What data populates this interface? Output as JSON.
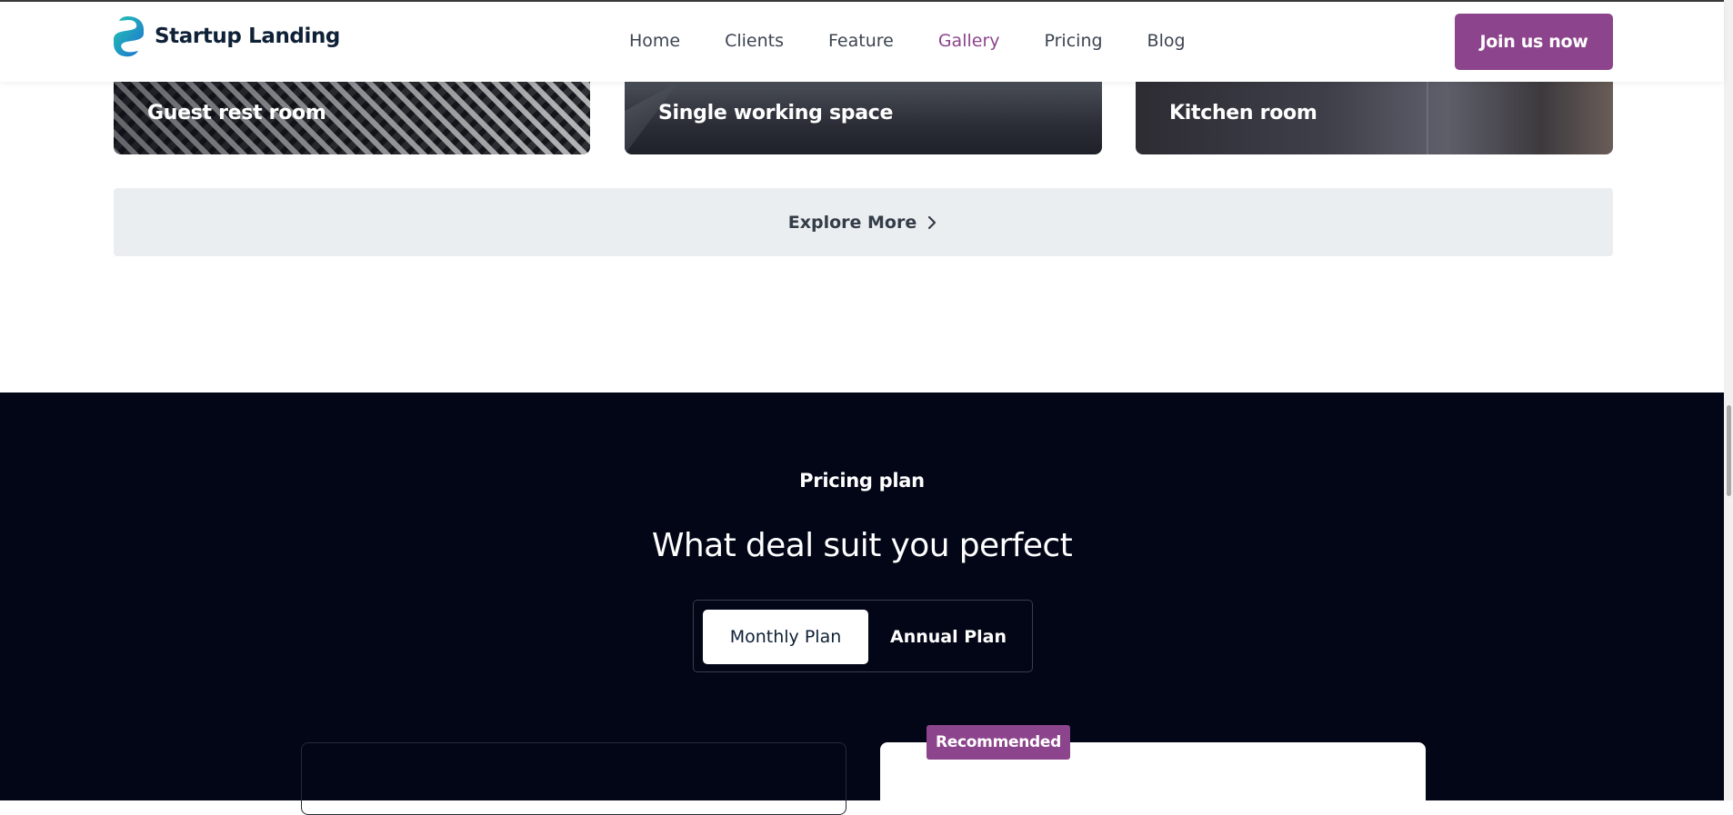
{
  "header": {
    "brand": "Startup Landing",
    "nav": [
      "Home",
      "Clients",
      "Feature",
      "Gallery",
      "Pricing",
      "Blog"
    ],
    "active_nav": "Gallery",
    "cta_label": "Join us now"
  },
  "gallery": {
    "cards": [
      {
        "label": "Guest rest room"
      },
      {
        "label": "Single working space"
      },
      {
        "label": "Kitchen room"
      }
    ],
    "explore_label": "Explore More"
  },
  "pricing": {
    "eyebrow": "Pricing plan",
    "heading": "What deal suit you perfect",
    "toggle": {
      "monthly": "Monthly Plan",
      "annual": "Annual Plan",
      "selected": "Monthly Plan"
    },
    "badge": "Recommended"
  },
  "colors": {
    "accent": "#8c458c",
    "dark_bg": "#020617",
    "explore_bg": "#ebeef1",
    "logo_teal": "#1dbfb0",
    "logo_blue": "#1d6fd6"
  }
}
